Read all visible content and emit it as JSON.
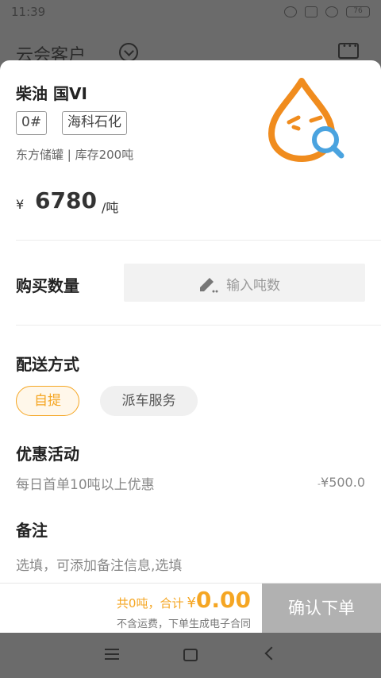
{
  "status_bar": {
    "time": "11:39",
    "battery": "76"
  },
  "app_header": {
    "title": "云会客户"
  },
  "product": {
    "name": "柴油 国VI",
    "tags": [
      "0#",
      "海科石化"
    ],
    "storage": "东方储罐 | 库存200吨",
    "price_currency": "¥",
    "price": "6780",
    "price_unit": "/吨"
  },
  "quantity": {
    "label": "购买数量",
    "placeholder": "输入吨数"
  },
  "delivery": {
    "label": "配送方式",
    "options": [
      "自提",
      "派车服务"
    ],
    "selected": "自提"
  },
  "promotion": {
    "label": "优惠活动",
    "text": "每日首单10吨以上优惠",
    "minus": "-",
    "amount": "¥500.0"
  },
  "remark": {
    "label": "备注",
    "placeholder": "选填，可添加备注信息,选填"
  },
  "footer": {
    "summary": "共0吨，合计",
    "currency": "¥",
    "total": "0.00",
    "note": "不含运费，下单生成电子合同",
    "confirm_label": "确认下单"
  },
  "colors": {
    "accent": "#f5a623",
    "mascot_orange": "#f08c1e",
    "mascot_blue": "#4aa3df",
    "disabled_button": "#b1b1b1"
  }
}
